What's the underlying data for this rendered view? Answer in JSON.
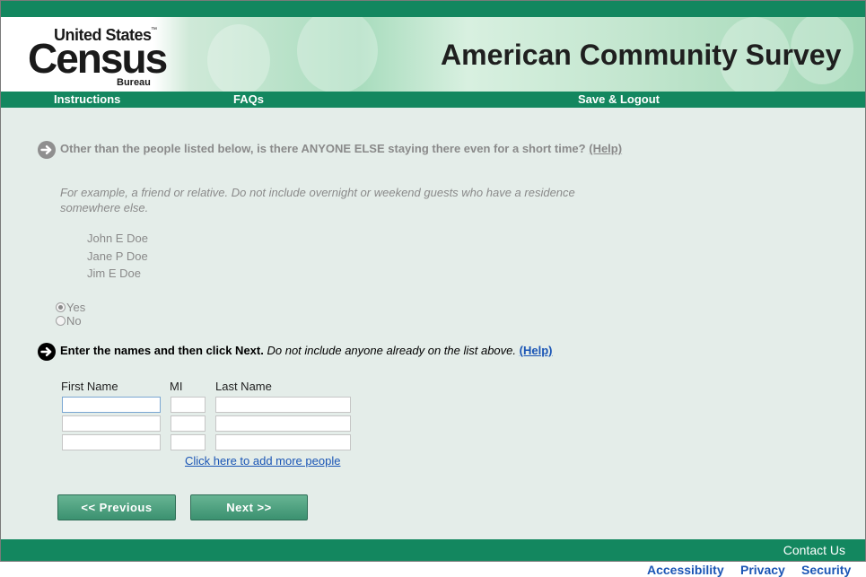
{
  "header": {
    "logo_line1": "United States",
    "logo_tm": "™",
    "logo_line2": "Census",
    "logo_line3": "Bureau",
    "title": "American Community Survey"
  },
  "nav": {
    "instructions": "Instructions",
    "faqs": "FAQs",
    "save_logout": "Save & Logout"
  },
  "question1": {
    "icon": "arrow-right-circle-icon",
    "text": "Other than the people listed below, is there ANYONE ELSE staying there even for a short time?",
    "help": "(Help)",
    "example": "For example, a friend or relative. Do not include overnight or weekend guests who have a residence somewhere else.",
    "people": [
      "John E Doe",
      "Jane P Doe",
      "Jim E Doe"
    ],
    "options": [
      {
        "label": "Yes",
        "checked": true
      },
      {
        "label": "No",
        "checked": false
      }
    ]
  },
  "question2": {
    "icon": "arrow-right-circle-icon",
    "bold_text": "Enter the names and then click Next.",
    "italic_text": "Do not include anyone already on the list above.",
    "help": "(Help)",
    "columns": {
      "first": "First Name",
      "mi": "MI",
      "last": "Last Name"
    },
    "rows": [
      {
        "first": "",
        "mi": "",
        "last": ""
      },
      {
        "first": "",
        "mi": "",
        "last": ""
      },
      {
        "first": "",
        "mi": "",
        "last": ""
      }
    ],
    "add_more": "Click here to add more people"
  },
  "buttons": {
    "previous": "<<   Previous",
    "next": "Next   >>"
  },
  "footer": {
    "contact": "Contact Us",
    "links": [
      "Accessibility",
      "Privacy",
      "Security"
    ]
  },
  "colors": {
    "brand_green": "#13875f",
    "content_bg": "#e4ede9",
    "link_blue": "#1a55b5"
  }
}
